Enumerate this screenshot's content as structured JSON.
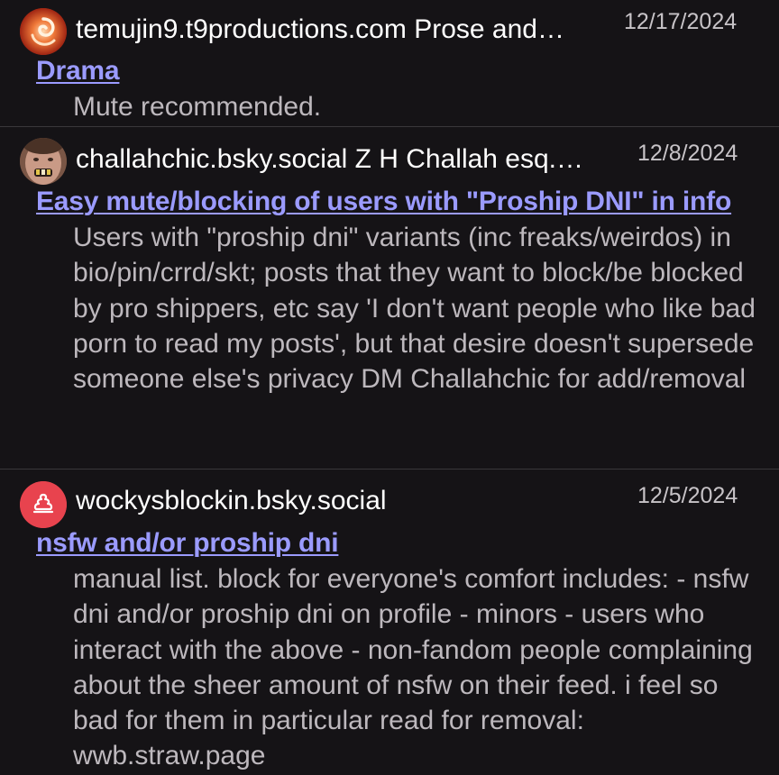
{
  "entries": [
    {
      "handle": "temujin9.t9productions.com Prose and…",
      "date": "12/17/2024",
      "title": "Drama",
      "description": "Mute recommended."
    },
    {
      "handle": "challahchic.bsky.social Z H Challah esq.…",
      "date": "12/8/2024",
      "title": "Easy mute/blocking of users with \"Proship DNI\" in info",
      "description": "Users with \"proship dni\" variants (inc freaks/weirdos) in bio/pin/crrd/skt; posts that they want to block/be blocked by pro shippers, etc say 'I don't want people who like bad porn to read my posts', but that desire doesn't supersede someone else's privacy DM Challahchic for add/removal"
    },
    {
      "handle": "wockysblockin.bsky.social",
      "date": "12/5/2024",
      "title": "nsfw and/or proship dni",
      "description": "manual list. block for everyone's comfort includes: - nsfw dni and/or proship dni on profile - minors - users who interact with the above - non-fandom people complaining about the sheer amount of nsfw on their feed. i feel so bad for them in particular read for removal: wwb.straw.page"
    }
  ],
  "colors": {
    "background": "#151316",
    "link": "#9b9bff",
    "body_text": "#bdb8bd",
    "date_text": "#c7c3c7",
    "avatar_3_bg": "#e8434e"
  },
  "icons": {
    "avatar_1": "orange-swirl-avatar",
    "avatar_2": "face-photo-avatar",
    "avatar_3": "poop-icon"
  }
}
